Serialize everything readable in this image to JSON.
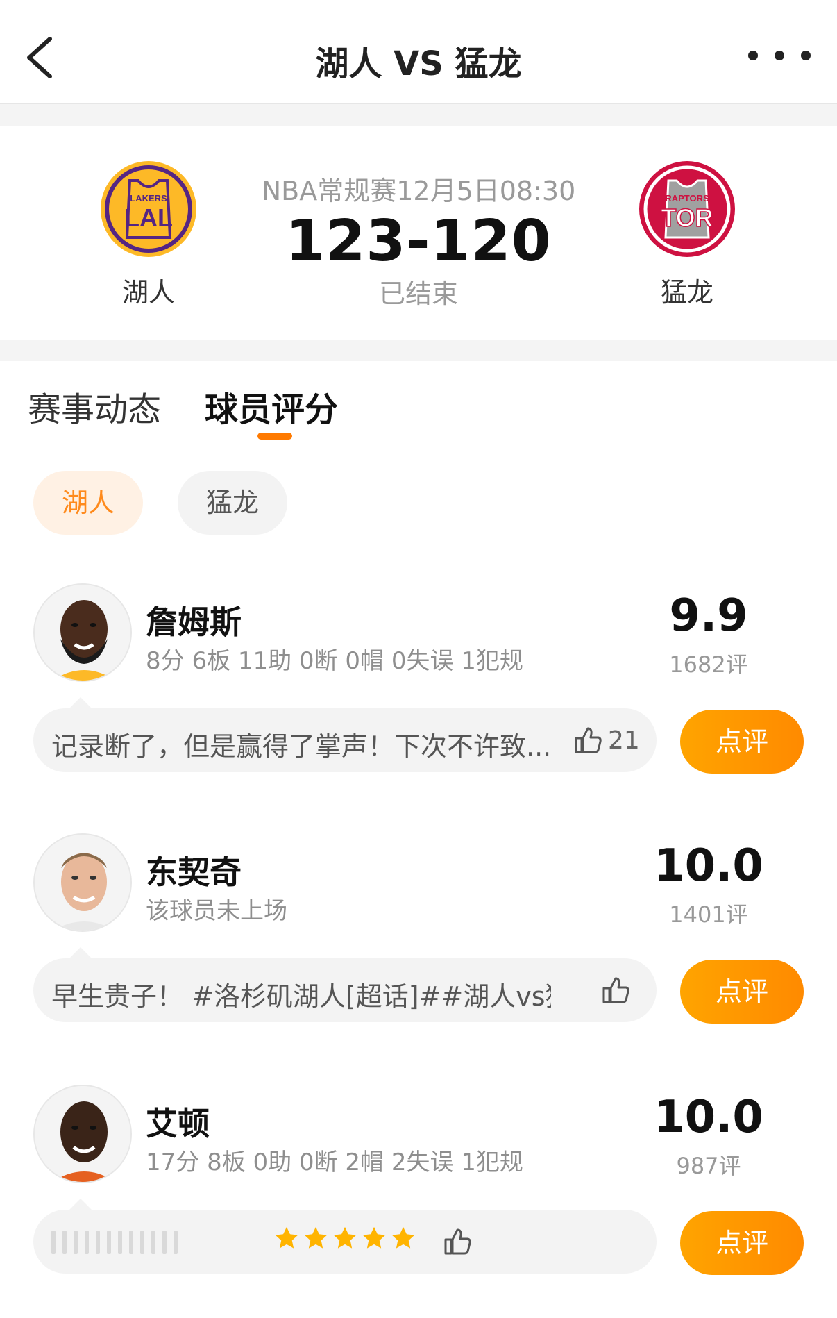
{
  "nav": {
    "title": "湖人 VS 猛龙"
  },
  "match": {
    "home": {
      "name": "湖人",
      "logo_top": "LAKERS",
      "logo_main": "LAL"
    },
    "away": {
      "name": "猛龙",
      "logo_top": "RAPTORS",
      "logo_main": "TOR"
    },
    "meta": "NBA常规赛12月5日08:30",
    "score": "123-120",
    "status": "已结束"
  },
  "tabs": [
    {
      "label": "赛事动态"
    },
    {
      "label": "球员评分"
    }
  ],
  "chips": [
    {
      "label": "湖人"
    },
    {
      "label": "猛龙"
    }
  ],
  "players": [
    {
      "name": "詹姆斯",
      "stats": "8分 6板 11助 0断 0帽 0失误 1犯规",
      "rating": "9.9",
      "rating_count": "1682评",
      "comment": "记录断了，但是赢得了掌声！下次不许致...",
      "likes": "21",
      "review_label": "点评"
    },
    {
      "name": "东契奇",
      "stats": "该球员未上场",
      "rating": "10.0",
      "rating_count": "1401评",
      "comment": "早生贵子！ #洛杉矶湖人[超话]##湖人vs猛...",
      "likes": "",
      "review_label": "点评"
    },
    {
      "name": "艾顿",
      "stats": "17分 8板 0助 0断 2帽 2失误 1犯规",
      "rating": "10.0",
      "rating_count": "987评",
      "comment_stars": 5,
      "likes": "",
      "review_label": "点评"
    }
  ],
  "colors": {
    "accent": "#ff8a00",
    "lakers_gold": "#fdb927",
    "lakers_purple": "#552583",
    "raptors_red": "#ce1141"
  }
}
